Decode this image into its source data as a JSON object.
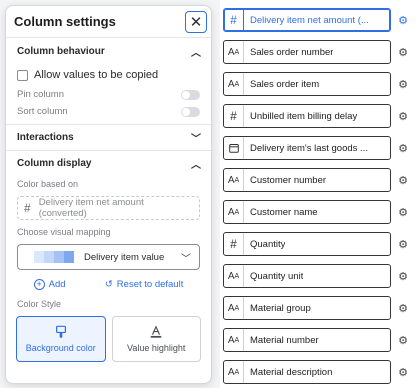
{
  "panel": {
    "title": "Column settings",
    "close_icon": "close-icon",
    "behaviour": {
      "header": "Column behaviour",
      "checkbox_label": "Allow values to be copied",
      "pin_label": "Pin column",
      "sort_label": "Sort column"
    },
    "interactions": {
      "header": "Interactions"
    },
    "display": {
      "header": "Column display",
      "color_based_on_label": "Color based on",
      "color_based_on_value": "Delivery item net amount (converted)",
      "mapping_label": "Choose visual mapping",
      "mapping_value": "Delivery item value",
      "add_label": "Add",
      "reset_label": "Reset to default",
      "color_style_label": "Color Style",
      "style_background": "Background color",
      "style_value": "Value highlight"
    }
  },
  "columns": [
    {
      "label": "Delivery item net amount (...",
      "icon": "#",
      "active": true
    },
    {
      "label": "Sales order number",
      "icon": "Aᴬ"
    },
    {
      "label": "Sales order item",
      "icon": "Aᴬ"
    },
    {
      "label": "Unbilled item billing delay",
      "icon": "#"
    },
    {
      "label": "Delivery item's last goods ...",
      "icon": "calendar"
    },
    {
      "label": "Customer number",
      "icon": "Aᴬ"
    },
    {
      "label": "Customer name",
      "icon": "Aᴬ"
    },
    {
      "label": "Quantity",
      "icon": "#"
    },
    {
      "label": "Quantity unit",
      "icon": "Aᴬ"
    },
    {
      "label": "Material group",
      "icon": "Aᴬ"
    },
    {
      "label": "Material number",
      "icon": "Aᴬ"
    },
    {
      "label": "Material description",
      "icon": "Aᴬ"
    }
  ],
  "colors": {
    "accent": "#2f6fe4",
    "swatches": [
      "#dbe7fb",
      "#c3d7f8",
      "#a4c2f3",
      "#7fa7ee"
    ]
  }
}
